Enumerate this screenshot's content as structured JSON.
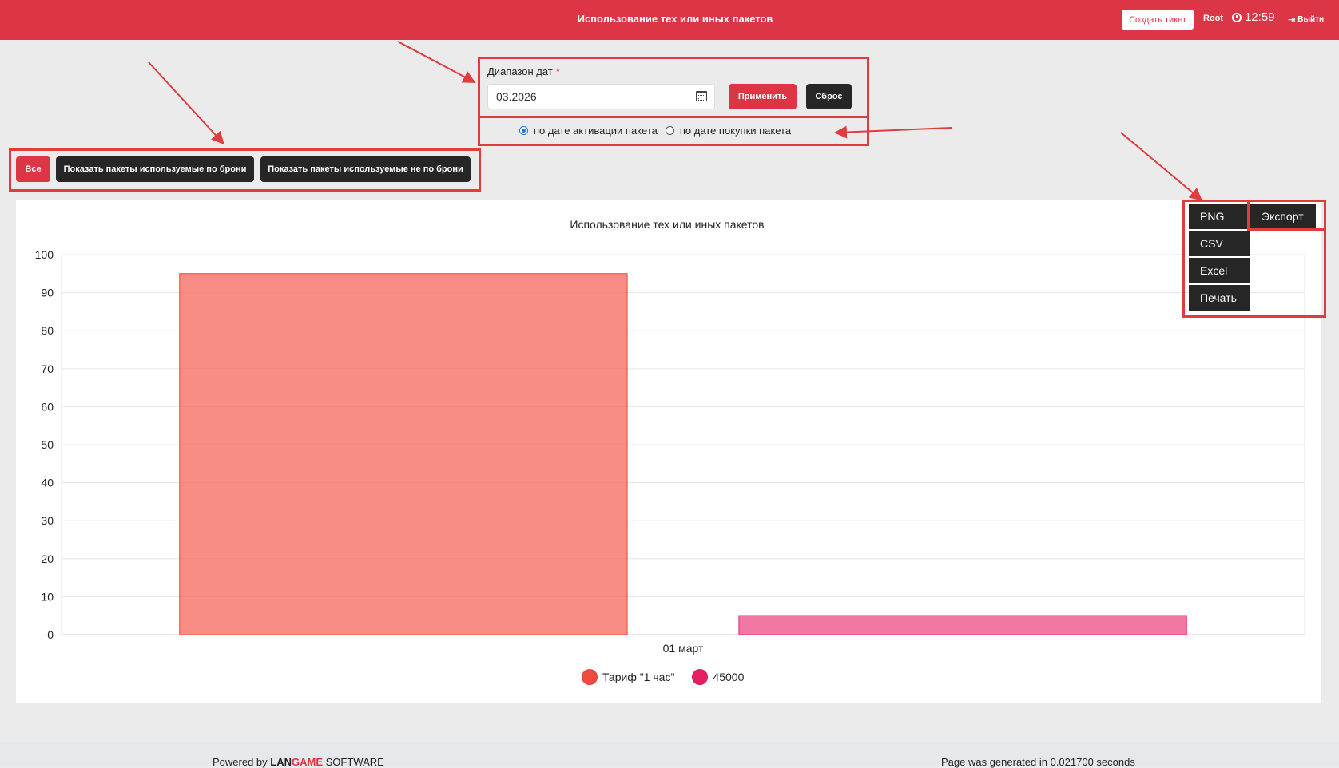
{
  "header": {
    "title": "Использование тех или иных пакетов",
    "ticket_label": "Создать тикет",
    "user": "Root",
    "time": "12:59",
    "logout_label": "Выйти"
  },
  "filter": {
    "date_label": "Диапазон дат",
    "required_mark": "*",
    "date_value": "03.2026",
    "apply_label": "Применить",
    "reset_label": "Сброс",
    "radio_activation": "по дате активации пакета",
    "radio_purchase": "по дате покупки пакета"
  },
  "segments": {
    "all": "Все",
    "by_booking": "Показать пакеты используемые по брони",
    "not_by_booking": "Показать пакеты используемые не по брони"
  },
  "export": {
    "toggle": "Экспорт",
    "options": [
      "PNG",
      "CSV",
      "Excel",
      "Печать"
    ]
  },
  "chart_data": {
    "type": "bar",
    "title": "Использование тех или иных пакетов",
    "categories": [
      "01 март"
    ],
    "series": [
      {
        "name": "Тариф \"1 час\"",
        "values": [
          95
        ],
        "color": "#f5675c"
      },
      {
        "name": "45000",
        "values": [
          5
        ],
        "color": "#ee4b86"
      }
    ],
    "ylim": [
      0,
      100
    ],
    "yticks": [
      0,
      10,
      20,
      30,
      40,
      50,
      60,
      70,
      80,
      90,
      100
    ],
    "grid": true,
    "legend_position": "bottom"
  },
  "footer": {
    "powered_by": "Powered by",
    "brand_lan": "LAN",
    "brand_game": "GAME",
    "brand_software": "SOFTWARE",
    "generated": "Page was generated in 0.021700 seconds"
  },
  "colors": {
    "accent": "#dc3545",
    "dark_button": "#262626",
    "annotation": "#e23b3b"
  }
}
